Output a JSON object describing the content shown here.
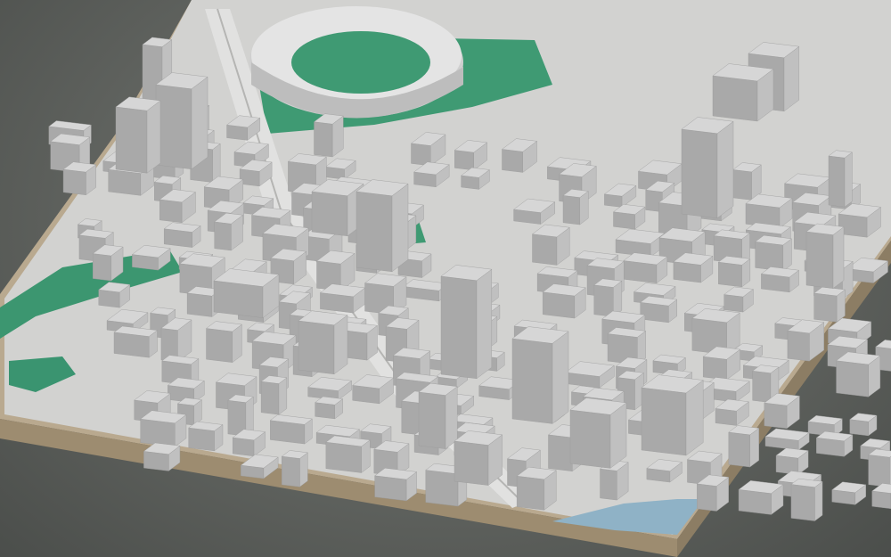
{
  "scene": {
    "kind": "3d-city-model",
    "colors": {
      "background": "#5f625e",
      "terrain_base": "#b8a78c",
      "terrain_edge": "#9a8a70",
      "building_top": "#d6d6d6",
      "building_left": "#a9a9a9",
      "building_right": "#c0c0c0",
      "road": "#cfcfcf",
      "park": "#3f9a73",
      "park_dark": "#2f7e5a",
      "water": "#8fb2c6"
    },
    "features": {
      "stadium": "stadium-green-field",
      "parks": [
        "riverside-park",
        "west-park",
        "small-square",
        "stadium-grounds"
      ],
      "river": "river-corner-southeast",
      "highway": "elevated-highway-corridor"
    }
  }
}
